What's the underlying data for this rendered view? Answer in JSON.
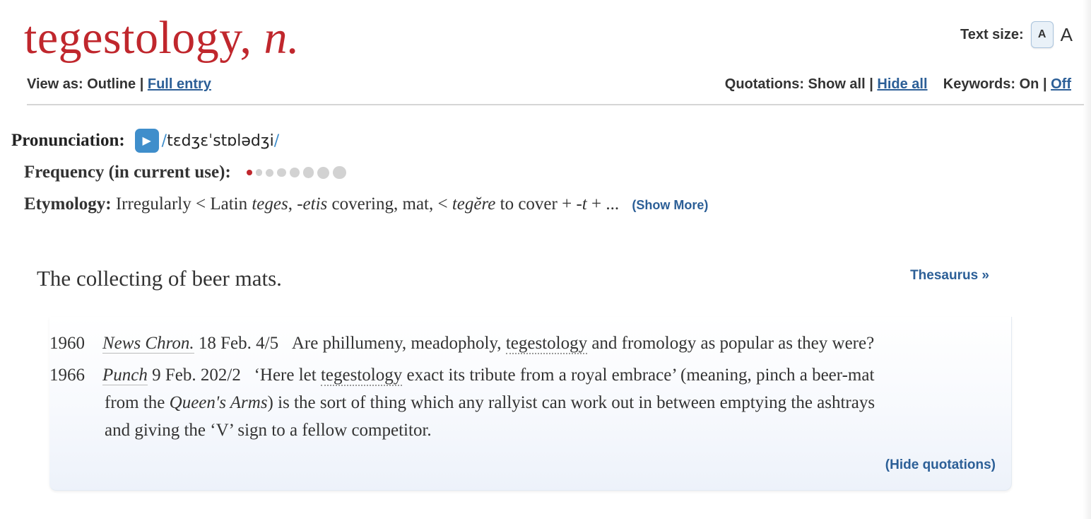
{
  "headword": {
    "word": "tegestology,",
    "pos": "n."
  },
  "text_size": {
    "label": "Text size:",
    "small": "A",
    "large": "A"
  },
  "view_as": {
    "label": "View as:",
    "current": "Outline",
    "separator": "|",
    "full_entry": "Full entry"
  },
  "quotations_ctl": {
    "label": "Quotations:",
    "show_all": "Show all",
    "separator": "|",
    "hide_all": "Hide all"
  },
  "keywords_ctl": {
    "label": "Keywords:",
    "on": "On",
    "separator": "|",
    "off": "Off"
  },
  "pronunciation": {
    "label": "Pronunciation:",
    "ipa": "tɛdʒɛˈstɒlədʒi",
    "slash": "/"
  },
  "frequency": {
    "label": "Frequency (in current use):",
    "level": 1,
    "total": 8,
    "active_color": "#c0272d",
    "inactive_color": "#d2d2d2"
  },
  "etymology": {
    "label": "Etymology:",
    "t1": " Irregularly < Latin ",
    "i1": "teges",
    "t2": ", ",
    "i2": "-etis",
    "t3": " covering, mat, < ",
    "i3": "tegĕre",
    "t4": " to cover + ",
    "i4": "-t",
    "t5": " + ...",
    "show_more": "(Show More)"
  },
  "definition": {
    "text": "The collecting of beer mats.",
    "thesaurus": "Thesaurus »"
  },
  "quotations": [
    {
      "year": "1960",
      "source": "News Chron.",
      "cite": " 18 Feb. 4/5",
      "t1": "Are phillumeny, meadopholy, ",
      "kw": "tegestology",
      "t2": " and fromology as popular as they were?"
    },
    {
      "year": "1966",
      "source": "Punch",
      "cite": " 9 Feb. 202/2",
      "t1": "‘Here let ",
      "kw": "tegestology",
      "t2": " exact its tribute from a royal embrace’ (meaning, pinch a beer-mat",
      "t3": "from the ",
      "i1": "Queen's Arms",
      "t4": ") is the sort of thing which any rallyist can work out in between emptying the ashtrays",
      "t5": "and giving the ‘V’ sign to a fellow competitor."
    }
  ],
  "hide_quotations": "(Hide quotations)",
  "colors": {
    "headword": "#c0272d",
    "link": "#2c5f97",
    "play_button": "#3f8ecb"
  },
  "icons": {
    "play": "play-icon"
  }
}
